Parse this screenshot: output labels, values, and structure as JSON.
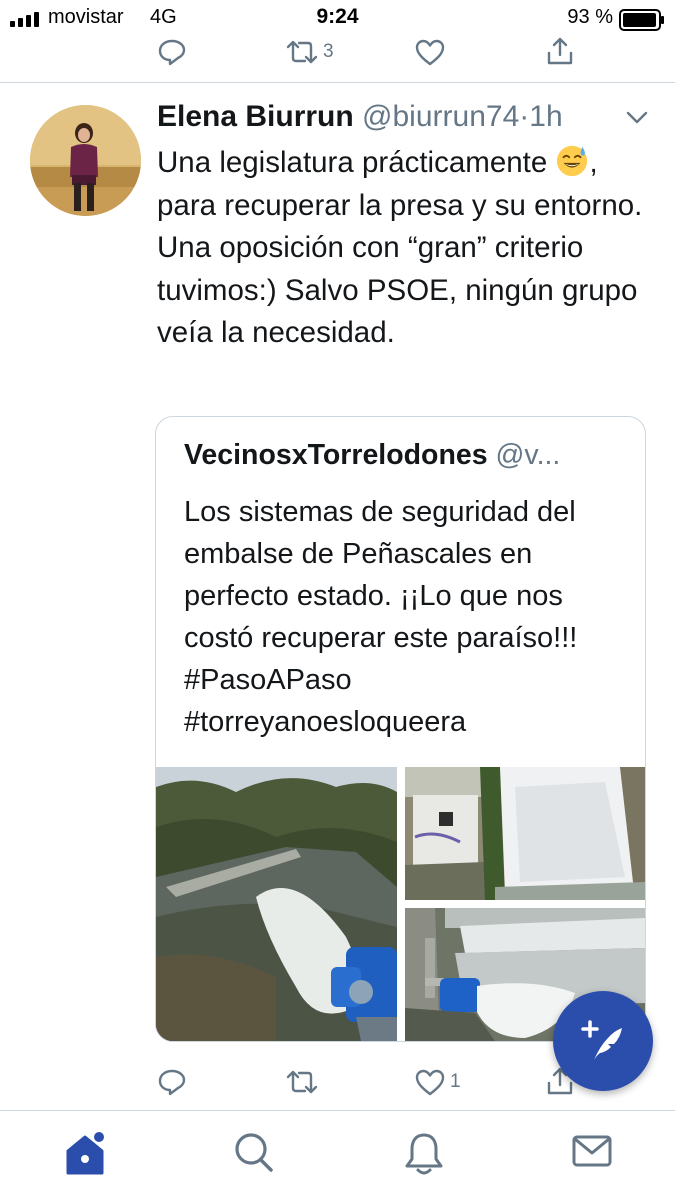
{
  "status_bar": {
    "carrier": "movistar",
    "network": "4G",
    "time": "9:24",
    "battery": "93 %"
  },
  "previous_tweet": {
    "retweet_count": "3"
  },
  "tweet": {
    "author_name": "Elena Biurrun",
    "author_handle": "@biurrun74",
    "separator": "·",
    "timestamp": "1h",
    "text_part1": "Una legislatura prácticamente ",
    "emoji": "sweat-smile-emoji",
    "text_part2": ", para recuperar la presa y su entorno. Una oposición con “gran” criterio tuvimos:) Salvo PSOE, ningún grupo veía la necesidad.",
    "like_count": "1"
  },
  "quoted_tweet": {
    "author_name": "VecinosxTorrelodones",
    "author_handle": "@v...",
    "text": "Los sistemas de seguridad del embalse de Peñascales en perfecto estado. ¡¡Lo que nos costó recuperar este paraíso!!! #PasoAPaso #torreyanoesloqueera",
    "photos": [
      "river-outflow-photo",
      "dam-building-spillway-photo",
      "spillway-pipe-photo"
    ]
  },
  "tab_bar": {
    "items": [
      "home-icon",
      "search-icon",
      "notifications-icon",
      "messages-icon"
    ]
  },
  "colors": {
    "accent": "#2b4eac",
    "text": "#14171a",
    "secondary": "#657786",
    "divider": "#cfd6dc"
  }
}
